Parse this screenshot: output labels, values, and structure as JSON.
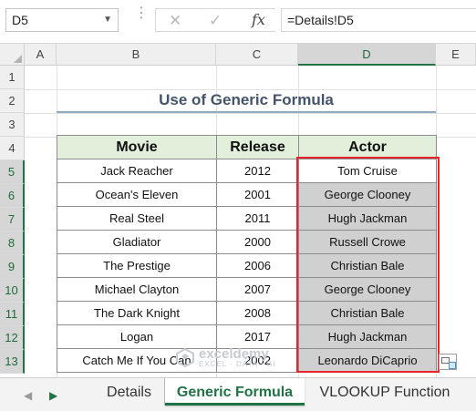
{
  "formula_bar": {
    "name_box": "D5",
    "cancel_icon": "cancel-icon",
    "enter_icon": "check-icon",
    "fx_label": "fx",
    "formula": "=Details!D5"
  },
  "grid": {
    "columns": [
      "A",
      "B",
      "C",
      "D",
      "E"
    ],
    "active_column": "D",
    "rows": [
      "1",
      "2",
      "3",
      "4",
      "5",
      "6",
      "7",
      "8",
      "9",
      "10",
      "11",
      "12",
      "13"
    ],
    "active_rows": [
      "5",
      "6",
      "7",
      "8",
      "9",
      "10",
      "11",
      "12",
      "13"
    ]
  },
  "sheet": {
    "title": "Use of Generic Formula",
    "headers": {
      "movie": "Movie",
      "release": "Release",
      "actor": "Actor"
    },
    "rows": [
      {
        "movie": "Jack Reacher",
        "release": "2012",
        "actor": "Tom Cruise"
      },
      {
        "movie": "Ocean's Eleven",
        "release": "2001",
        "actor": "George Clooney"
      },
      {
        "movie": "Real Steel",
        "release": "2011",
        "actor": "Hugh Jackman"
      },
      {
        "movie": "Gladiator",
        "release": "2000",
        "actor": "Russell Crowe"
      },
      {
        "movie": "The Prestige",
        "release": "2006",
        "actor": "Christian Bale"
      },
      {
        "movie": "Michael Clayton",
        "release": "2007",
        "actor": "George Clooney"
      },
      {
        "movie": "The Dark Knight",
        "release": "2008",
        "actor": "Christian Bale"
      },
      {
        "movie": "Logan",
        "release": "2017",
        "actor": "Hugh Jackman"
      },
      {
        "movie": "Catch Me If You Can",
        "release": "2002",
        "actor": "Leonardo DiCaprio"
      }
    ]
  },
  "watermark": {
    "brand": "exceldemy",
    "tagline": "EXCEL · DATA · BI"
  },
  "tabs": {
    "items": [
      "Details",
      "Generic Formula",
      "VLOOKUP Function"
    ],
    "active": "Generic Formula"
  },
  "colors": {
    "accent": "#217346",
    "highlight": "#e8242b",
    "header_fill": "#e2efda",
    "selection_fill": "#d0d0d0"
  }
}
